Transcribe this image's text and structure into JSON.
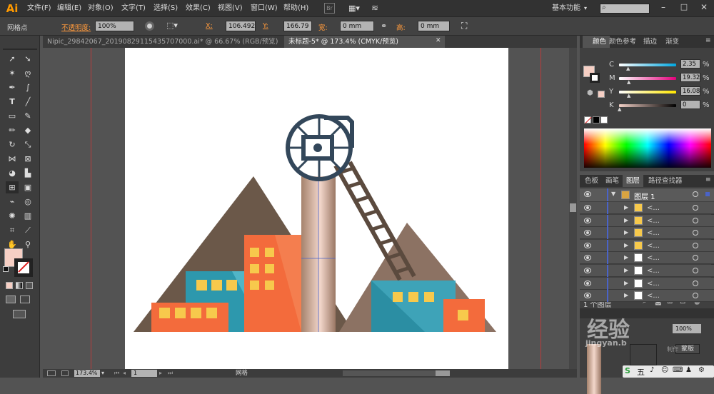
{
  "app": {
    "logo": "Ai",
    "workspace": "基本功能"
  },
  "menu": [
    "文件(F)",
    "编辑(E)",
    "对象(O)",
    "文字(T)",
    "选择(S)",
    "效果(C)",
    "视图(V)",
    "窗口(W)",
    "帮助(H)"
  ],
  "control": {
    "mode_label": "网格点",
    "opacity_label": "不透明度:",
    "opacity_value": "100%",
    "x_label": "X:",
    "x_value": "106.492",
    "y_label": "Y:",
    "y_value": "166.79",
    "w_label": "宽:",
    "w_value": "0 mm",
    "h_label": "高:",
    "h_value": "0 mm"
  },
  "tabs": [
    {
      "label": "Nipic_29842067_20190829115435707000.ai* @ 66.67% (RGB/预览)",
      "active": false
    },
    {
      "label": "未标题-5* @ 173.4% (CMYK/预览)",
      "active": true
    }
  ],
  "color_panel": {
    "tabs": [
      "颜色",
      "颜色参考",
      "描边",
      "渐变"
    ],
    "channels": [
      {
        "name": "C",
        "value": "2.35",
        "unit": "%",
        "level": 0.02
      },
      {
        "name": "M",
        "value": "19.32",
        "unit": "%",
        "level": 0.19
      },
      {
        "name": "Y",
        "value": "16.08",
        "unit": "%",
        "level": 0.16
      },
      {
        "name": "K",
        "value": "0",
        "unit": "%",
        "level": 0
      }
    ],
    "fill_color": "#f6cfc4"
  },
  "layers_panel": {
    "tabs": [
      "色板",
      "画笔",
      "图层",
      "路径查找器"
    ],
    "layer_name": "图层 1",
    "sublayer_label": "<...",
    "sublayer_count": 8,
    "footer": "1 个图层"
  },
  "status": {
    "zoom": "173.4%",
    "page": "1",
    "mode": "网格"
  },
  "watermark": {
    "text1": "经验",
    "text2": "jingyan.b",
    "tail": "蒙版",
    "tail2": "制作"
  }
}
